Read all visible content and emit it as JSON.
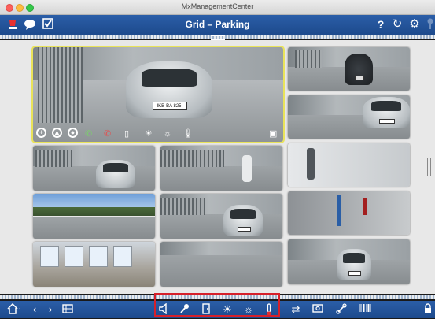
{
  "window": {
    "title": "MxManagementCenter"
  },
  "topbar": {
    "title": "Grid – Parking",
    "left_icons": [
      "alarm-icon",
      "chat-icon",
      "checkbox-icon"
    ],
    "right_icons": [
      "help-icon",
      "refresh-icon",
      "settings-icon",
      "pin-icon"
    ],
    "help_glyph": "?",
    "refresh_glyph": "↻",
    "settings_glyph": "⚙"
  },
  "plates": {
    "main": "IKB·BA 825"
  },
  "bottombar": {
    "left_icons": [
      "home-icon",
      "back-icon",
      "forward-icon",
      "layout-icon"
    ],
    "highlighted_icons": [
      "speaker-icon",
      "microphone-icon",
      "door-icon",
      "light-on-icon",
      "light-off-icon",
      "thermometer-icon"
    ],
    "right_icons": [
      "swap-icon",
      "snapshot-icon",
      "link-icon",
      "barcode-icon",
      "lock-icon"
    ],
    "highlight_color": "#d6202a"
  },
  "accent_color": "#1d4a8c"
}
